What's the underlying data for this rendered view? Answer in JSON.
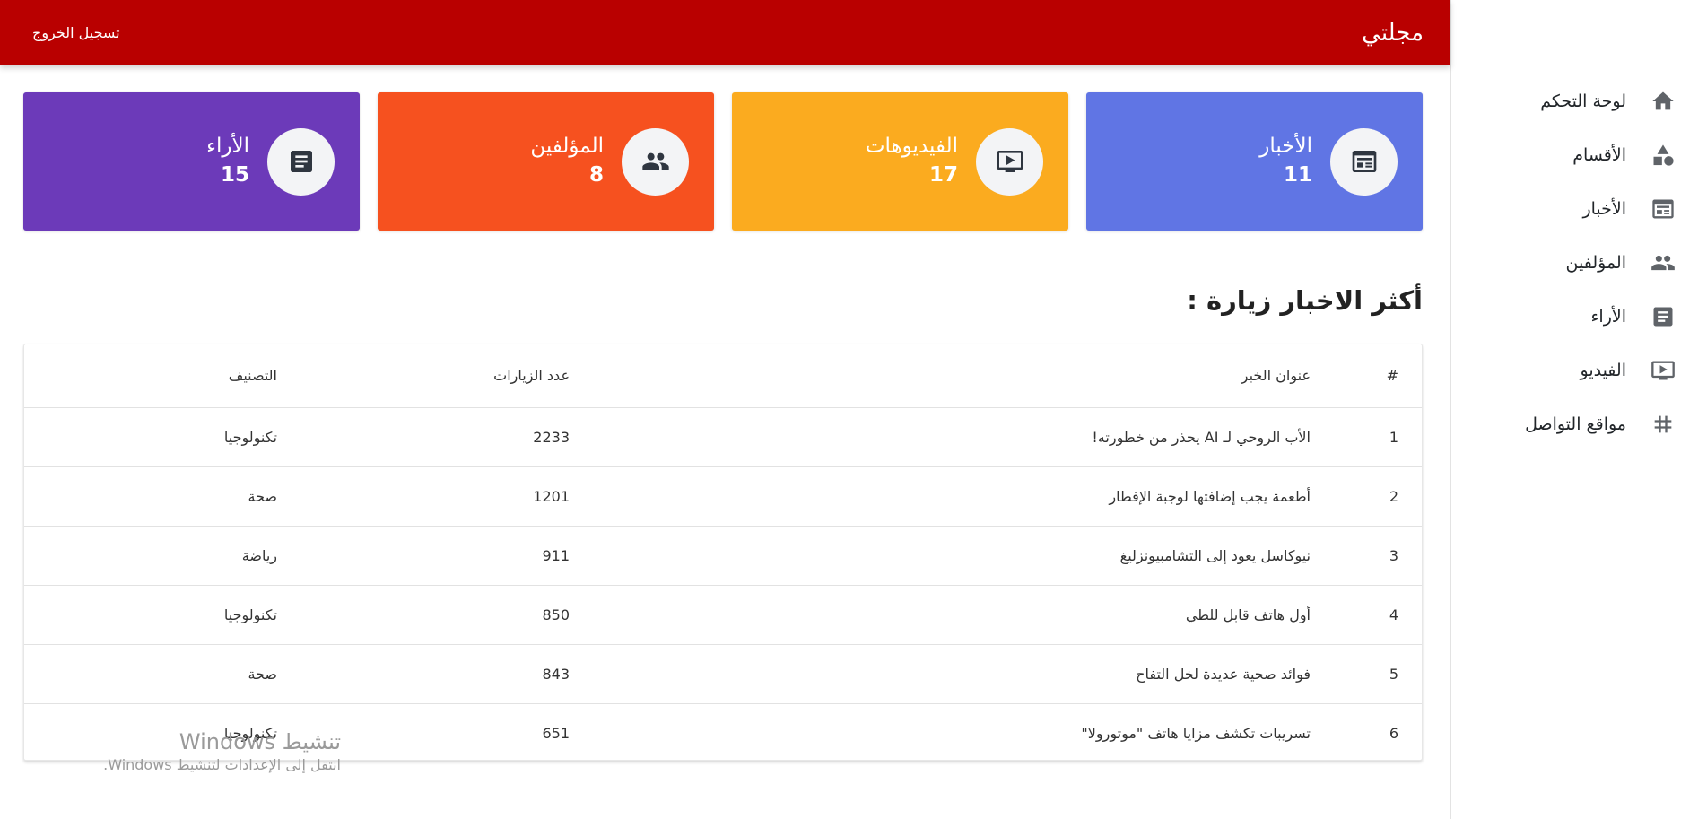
{
  "header": {
    "brand": "مجلتي",
    "logout": "تسجيل الخروج",
    "color": "#b90000"
  },
  "sidebar": {
    "items": [
      {
        "label": "لوحة التحكم",
        "icon": "home-icon"
      },
      {
        "label": "الأقسام",
        "icon": "shapes-icon"
      },
      {
        "label": "الأخبار",
        "icon": "newspaper-icon"
      },
      {
        "label": "المؤلفين",
        "icon": "people-icon"
      },
      {
        "label": "الأراء",
        "icon": "article-icon"
      },
      {
        "label": "الفيديو",
        "icon": "video-icon"
      },
      {
        "label": "مواقع التواصل",
        "icon": "hashtag-icon"
      }
    ]
  },
  "stats": [
    {
      "title": "الأخبار",
      "count": "11",
      "color": "#6075e4",
      "icon": "newspaper-icon"
    },
    {
      "title": "الفيديوهات",
      "count": "17",
      "color": "#fbab1f",
      "icon": "video-icon"
    },
    {
      "title": "المؤلفين",
      "count": "8",
      "color": "#f6511f",
      "icon": "people-icon"
    },
    {
      "title": "الأراء",
      "count": "15",
      "color": "#6c3ab9",
      "icon": "article-icon"
    }
  ],
  "section": {
    "title": "أكثر الاخبار زيارة :"
  },
  "table": {
    "headers": {
      "num": "#",
      "title": "عنوان الخبر",
      "visits": "عدد الزيارات",
      "category": "التصنيف"
    },
    "rows": [
      {
        "num": "1",
        "title": "الأب الروحي لـ AI يحذر من خطورته!",
        "visits": "2233",
        "category": "تكنولوجيا"
      },
      {
        "num": "2",
        "title": "أطعمة يجب إضافتها لوجبة الإفطار",
        "visits": "1201",
        "category": "صحة"
      },
      {
        "num": "3",
        "title": "نيوكاسل يعود إلى التشامبيونزليغ",
        "visits": "911",
        "category": "رياضة"
      },
      {
        "num": "4",
        "title": "أول هاتف قابل للطي",
        "visits": "850",
        "category": "تكنولوجيا"
      },
      {
        "num": "5",
        "title": "فوائد صحية عديدة لخل التفاح",
        "visits": "843",
        "category": "صحة"
      },
      {
        "num": "6",
        "title": "تسريبات تكشف مزايا هاتف \"موتورولا\"",
        "visits": "651",
        "category": "تكنولوجيا"
      }
    ]
  },
  "watermark": {
    "title": "تنشيط Windows",
    "subtitle": "انتقل إلى الإعدادات لتنشيط Windows."
  }
}
